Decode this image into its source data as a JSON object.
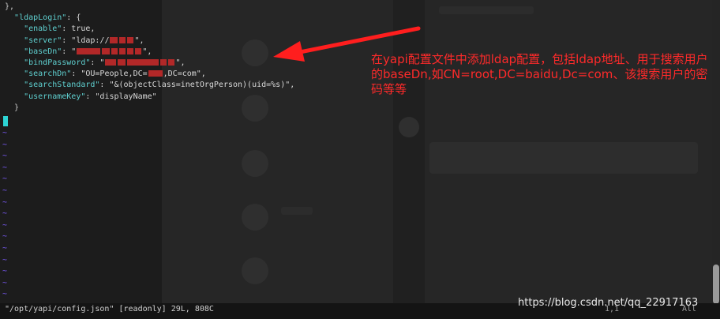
{
  "editor": {
    "code_lines": [
      {
        "text": "},",
        "kind": "plain"
      },
      {
        "key": "\"ldapLogin\"",
        "rest": ": {"
      },
      {
        "key": "\"enable\"",
        "rest": ": true,"
      },
      {
        "key": "\"server\"",
        "rest": ": \"ldap://",
        "redacted": true,
        "tail": "\","
      },
      {
        "key": "\"baseDn\"",
        "rest": ": \"",
        "redacted": true,
        "tail": "\","
      },
      {
        "key": "\"bindPassword\"",
        "rest": ": \"",
        "redacted": true,
        "tail": "\","
      },
      {
        "key": "\"searchDn\"",
        "rest": ": \"OU=People,DC=",
        "redacted": true,
        "tail": ",DC=com\","
      },
      {
        "key": "\"searchStandard\"",
        "rest": ": \"&(objectClass=inetOrgPerson)(uid=%s)\","
      },
      {
        "key": "\"usernameKey\"",
        "rest": ": \"displayName\""
      },
      {
        "text": "}",
        "kind": "plain"
      }
    ],
    "tilde_lines": "~\n~\n~\n~\n~\n~\n~\n~\n~\n~\n~\n~\n~\n~\n~"
  },
  "status": {
    "file": "\"/opt/yapi/config.json\" [readonly] 29L, 808C",
    "position": "1,1",
    "scroll": "All"
  },
  "annotation": {
    "text": "在yapi配置文件中添加ldap配置，包括ldap地址、用于搜索用户的baseDn,如CN=root,DC=baidu,Dc=com、该搜索用户的密码等等",
    "color": "#ff2a2a"
  },
  "watermark": "https://blog.csdn.net/qq_22917163"
}
